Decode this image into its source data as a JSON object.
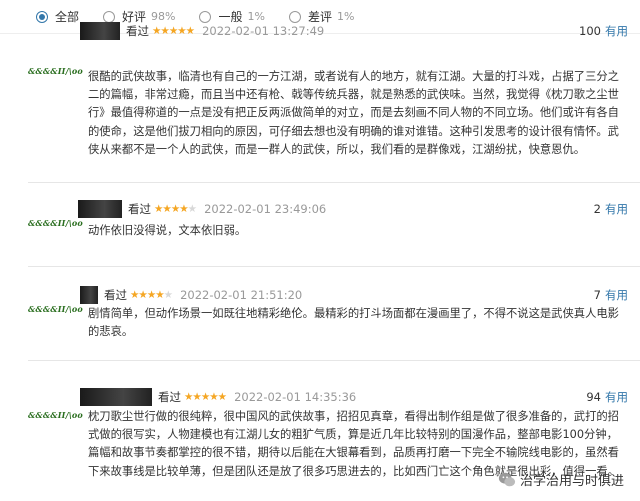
{
  "filters": [
    {
      "label": "全部",
      "pct": "",
      "checked": true
    },
    {
      "label": "好评",
      "pct": "98%",
      "checked": false
    },
    {
      "label": "一般",
      "pct": "1%",
      "checked": false
    },
    {
      "label": "差评",
      "pct": "1%",
      "checked": false
    }
  ],
  "reviews": [
    {
      "avatar_text": "&&&&II/\\oo",
      "rating_label": "看过",
      "stars": 5,
      "time": "2022-02-01 13:27:49",
      "votes": "100",
      "useful_label": "有用",
      "content": "很酷的武侠故事，临清也有自己的一方江湖，或者说有人的地方，就有江湖。大量的打斗戏，占据了三分之二的篇幅，非常过瘾，而且当中还有枪、戟等传统兵器，就是熟悉的武侠味。当然，我觉得《枕刀歌之尘世行》最值得称道的一点是没有把正反两派做简单的对立，而是去刻画不同人物的不同立场。他们或许有各自的使命，这是他们拔刀相向的原因，可仔细去想也没有明确的谁对谁错。这种引发思考的设计很有情怀。武侠从来都不是一个人的武侠，而是一群人的武侠，所以，我们看的是群像戏，江湖纷扰，快意恩仇。"
    },
    {
      "avatar_text": "&&&&II/\\oo",
      "rating_label": "看过",
      "stars": 4,
      "time": "2022-02-01 23:49:06",
      "votes": "2",
      "useful_label": "有用",
      "content": "动作依旧没得说，文本依旧弱。"
    },
    {
      "avatar_text": "&&&&II/\\oo",
      "rating_label": "看过",
      "stars": 4,
      "time": "2022-02-01 21:51:20",
      "votes": "7",
      "useful_label": "有用",
      "content": "剧情简单，但动作场景一如既往地精彩绝伦。最精彩的打斗场面都在漫画里了，不得不说这是武侠真人电影的悲哀。"
    },
    {
      "avatar_text": "&&&&II/\\oo",
      "rating_label": "看过",
      "stars": 5,
      "time": "2022-02-01 14:35:36",
      "votes": "94",
      "useful_label": "有用",
      "content": "枕刀歌尘世行做的很纯粹，很中国风的武侠故事，招招见真章，看得出制作组是做了很多准备的，武打的招式做的很写实，人物建模也有江湖儿女的粗犷气质，算是近几年比较特别的国漫作品，整部电影100分钟，篇幅和故事节奏都掌控的很不错，期待以后能在大银幕看到，品质再打磨一下完全不输院线电影的，虽然看下来故事线是比较单薄，但是团队还是放了很多巧思进去的，比如西门亡这个角色就是很出彩，值得一看。"
    }
  ],
  "watermark": {
    "text": "治学治用与时俱进"
  }
}
